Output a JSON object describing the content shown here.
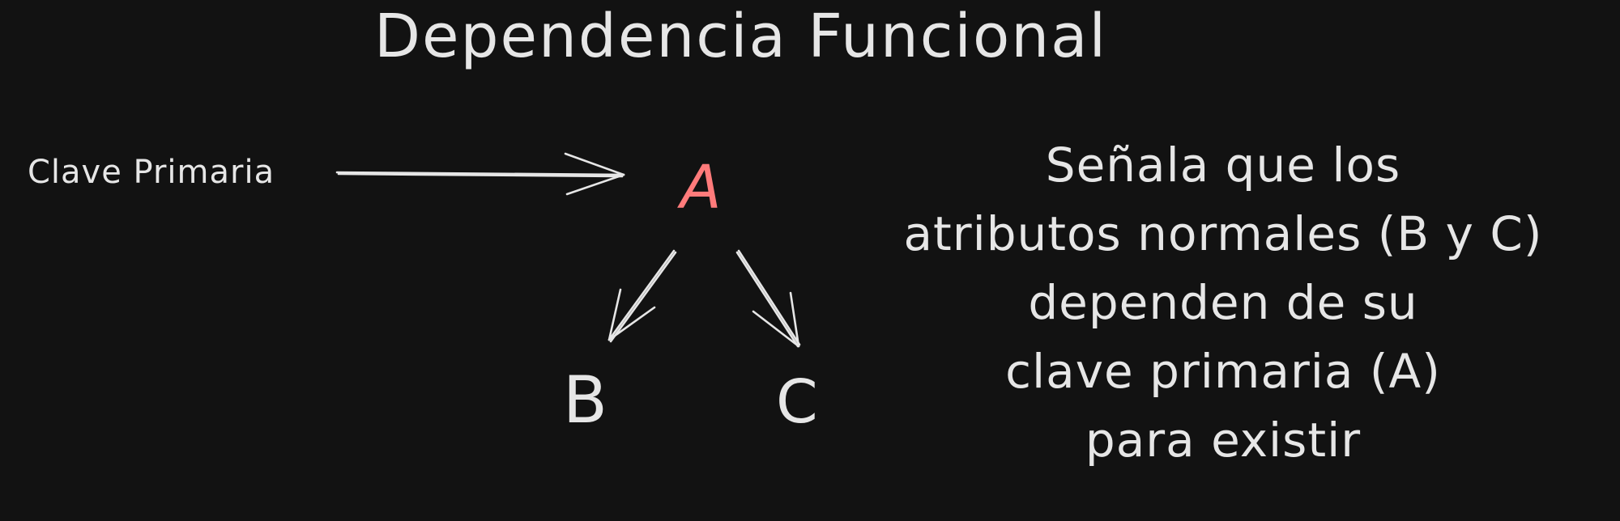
{
  "diagram": {
    "title": "Dependencia Funcional",
    "primary_key_label": "Clave Primaria",
    "nodes": {
      "a": "A",
      "b": "B",
      "c": "C"
    },
    "description_lines": [
      "Señala que los",
      "atributos normales (B y C)",
      "dependen de su",
      "clave primaria (A)",
      "para existir"
    ]
  },
  "colors": {
    "background": "#121212",
    "text": "#e6e6e6",
    "accent": "#ff7b7b",
    "arrows": "#e6e6e6"
  }
}
